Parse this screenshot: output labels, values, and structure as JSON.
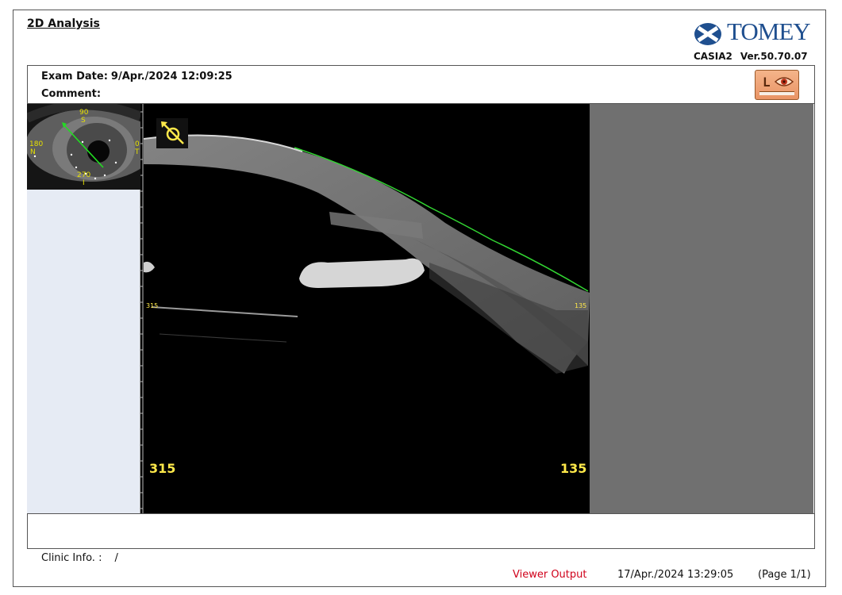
{
  "report": {
    "title": "2D Analysis",
    "brand": "TOMEY",
    "device": "CASIA2",
    "version": "Ver.50.70.07"
  },
  "exam": {
    "date_label": "Exam Date:",
    "date_value": "9/Apr./2024 12:09:25",
    "comment_label": "Comment:",
    "comment_value": ""
  },
  "eye_selector": {
    "letter": "L",
    "icon": "eye-icon"
  },
  "thumbnail": {
    "labels": {
      "top_angle": "90",
      "top_dir": "S",
      "left_angle": "180",
      "left_dir": "N",
      "right_angle": "0",
      "right_dir": "T",
      "bottom_angle": "270",
      "bottom_dir": "I"
    },
    "scan_line_color": "#22dd22"
  },
  "scan": {
    "left_angle_small": "315",
    "right_angle_small": "135",
    "left_angle": "315",
    "right_angle": "135",
    "orientation_icon": "orientation-arrow-icon",
    "label_color": "#ffe94a",
    "contour_color": "#32d632"
  },
  "footer": {
    "clinic_label": "Clinic Info. :",
    "clinic_value": "/",
    "viewer_output": "Viewer Output",
    "timestamp": "17/Apr./2024 13:29:05",
    "page": "(Page 1/1)"
  }
}
